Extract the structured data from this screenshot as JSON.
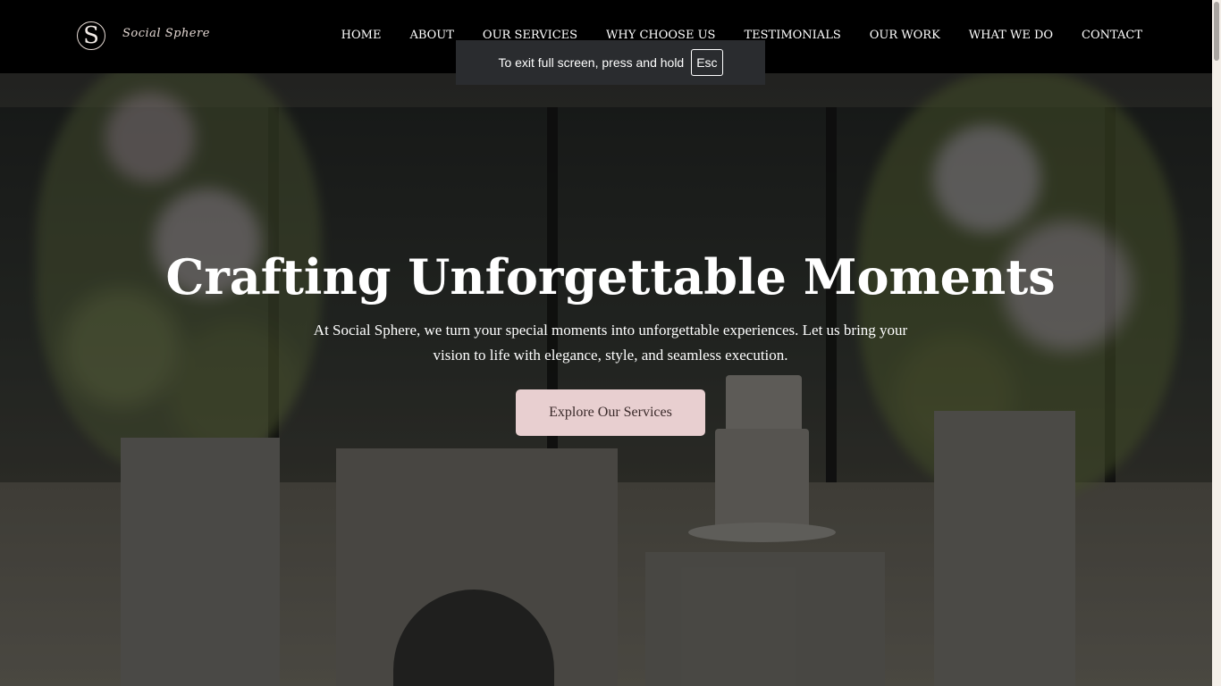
{
  "brand": {
    "logo_letter": "S",
    "name": "Social Sphere"
  },
  "nav": {
    "items": [
      {
        "label": "HOME"
      },
      {
        "label": "ABOUT"
      },
      {
        "label": "OUR SERVICES"
      },
      {
        "label": "WHY CHOOSE US"
      },
      {
        "label": "TESTIMONIALS"
      },
      {
        "label": "OUR WORK"
      },
      {
        "label": "WHAT WE DO"
      },
      {
        "label": "CONTACT"
      }
    ]
  },
  "fullscreen_notice": {
    "text": "To exit full screen, press and hold",
    "key": "Esc"
  },
  "hero": {
    "title": "Crafting Unforgettable Moments",
    "subtitle": "At Social Sphere, we turn your special moments into unforgettable experiences. Let us bring your vision to life with elegance, style, and seamless execution.",
    "cta_label": "Explore Our Services"
  },
  "colors": {
    "navbar_bg": "#000000",
    "cta_bg": "#e8cfd0",
    "notice_bg": "#2a2c2f"
  }
}
